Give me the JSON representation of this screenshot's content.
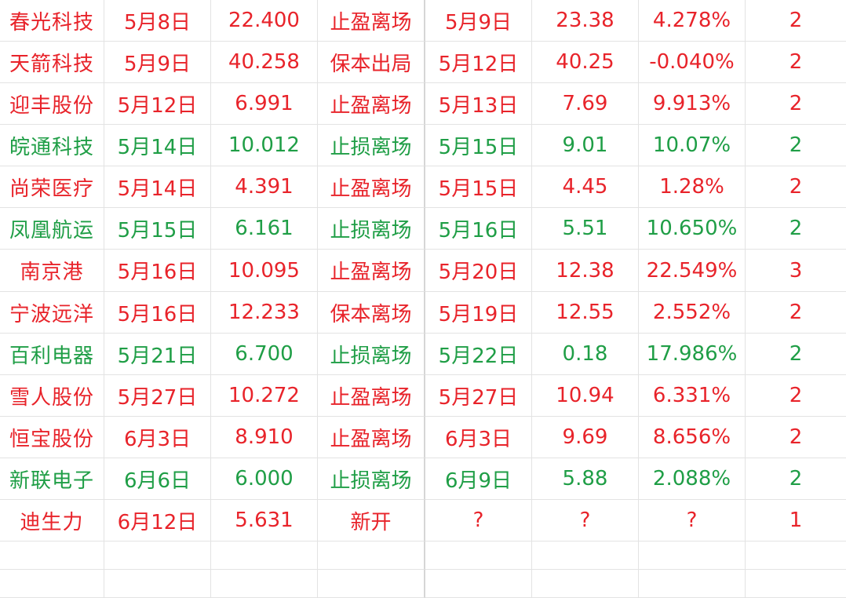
{
  "colors": {
    "up": "#e8232a",
    "down": "#1f9e46",
    "grid": "#e3e3e3"
  },
  "rows": [
    {
      "color": "red",
      "cells": [
        "春光科技",
        "5月8日",
        "22.400",
        "止盈离场",
        "5月9日",
        "23.38",
        "4.278%",
        "2"
      ]
    },
    {
      "color": "red",
      "cells": [
        "天箭科技",
        "5月9日",
        "40.258",
        "保本出局",
        "5月12日",
        "40.25",
        "-0.040%",
        "2"
      ]
    },
    {
      "color": "red",
      "cells": [
        "迎丰股份",
        "5月12日",
        "6.991",
        "止盈离场",
        "5月13日",
        "7.69",
        "9.913%",
        "2"
      ]
    },
    {
      "color": "green",
      "cells": [
        "皖通科技",
        "5月14日",
        "10.012",
        "止损离场",
        "5月15日",
        "9.01",
        "10.07%",
        "2"
      ]
    },
    {
      "color": "red",
      "cells": [
        "尚荣医疗",
        "5月14日",
        "4.391",
        "止盈离场",
        "5月15日",
        "4.45",
        "1.28%",
        "2"
      ]
    },
    {
      "color": "green",
      "cells": [
        "凤凰航运",
        "5月15日",
        "6.161",
        "止损离场",
        "5月16日",
        "5.51",
        "10.650%",
        "2"
      ]
    },
    {
      "color": "red",
      "cells": [
        "南京港",
        "5月16日",
        "10.095",
        "止盈离场",
        "5月20日",
        "12.38",
        "22.549%",
        "3"
      ]
    },
    {
      "color": "red",
      "cells": [
        "宁波远洋",
        "5月16日",
        "12.233",
        "保本离场",
        "5月19日",
        "12.55",
        "2.552%",
        "2"
      ]
    },
    {
      "color": "green",
      "cells": [
        "百利电器",
        "5月21日",
        "6.700",
        "止损离场",
        "5月22日",
        "0.18",
        "17.986%",
        "2"
      ]
    },
    {
      "color": "red",
      "cells": [
        "雪人股份",
        "5月27日",
        "10.272",
        "止盈离场",
        "5月27日",
        "10.94",
        "6.331%",
        "2"
      ]
    },
    {
      "color": "red",
      "cells": [
        "恒宝股份",
        "6月3日",
        "8.910",
        "止盈离场",
        "6月3日",
        "9.69",
        "8.656%",
        "2"
      ]
    },
    {
      "color": "green",
      "cells": [
        "新联电子",
        "6月6日",
        "6.000",
        "止损离场",
        "6月9日",
        "5.88",
        "2.088%",
        "2"
      ]
    },
    {
      "color": "red",
      "cells": [
        "迪生力",
        "6月12日",
        "5.631",
        "新开",
        "?",
        "?",
        "?",
        "1"
      ]
    },
    {
      "color": "",
      "cells": [
        "",
        "",
        "",
        "",
        "",
        "",
        "",
        ""
      ]
    },
    {
      "color": "",
      "cells": [
        "",
        "",
        "",
        "",
        "",
        "",
        "",
        ""
      ]
    }
  ]
}
